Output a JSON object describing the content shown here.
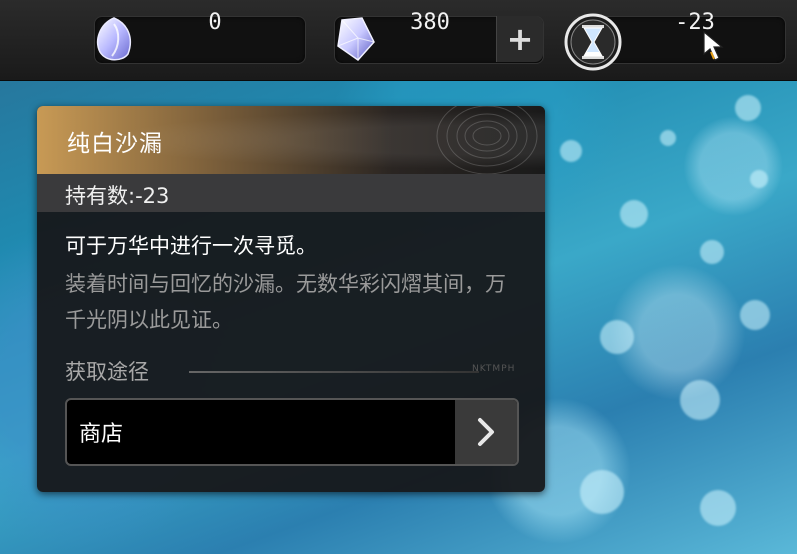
{
  "topbar": {
    "currencies": [
      {
        "icon": "crystal-leaf-icon",
        "value": "0"
      },
      {
        "icon": "crystal-gem-icon",
        "value": "380",
        "add_label": "+"
      },
      {
        "icon": "hourglass-icon",
        "value": "-23"
      }
    ]
  },
  "item": {
    "title": "纯白沙漏",
    "owned": "持有数:-23",
    "description": "可于万华中进行一次寻觅。",
    "flavor": "装着时间与回忆的沙漏。无数华彩闪熠其间，万千光阴以此见证。",
    "source_label": "获取途径",
    "source_deco": "NKTMPH",
    "sources": [
      {
        "label": "商店"
      }
    ]
  },
  "colors": {
    "header_gold": "#c89a55",
    "panel_bg": "#161618",
    "owned_bg": "#3a3a3c"
  }
}
